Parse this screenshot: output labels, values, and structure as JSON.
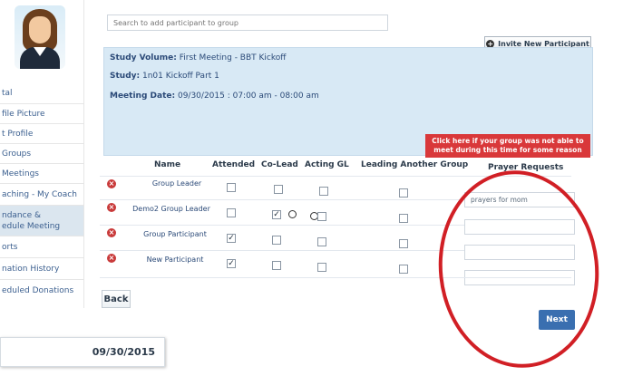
{
  "sidebar": {
    "items": [
      {
        "label": "tal"
      },
      {
        "label": "file Picture"
      },
      {
        "label": "t Profile"
      },
      {
        "label": "Groups"
      },
      {
        "label": "Meetings"
      },
      {
        "label": "aching - My Coach"
      },
      {
        "label": "ndance &\nedule Meeting"
      },
      {
        "label": "orts"
      },
      {
        "label": "nation History"
      },
      {
        "label": "eduled Donations"
      }
    ]
  },
  "search": {
    "placeholder": "Search to add participant to group"
  },
  "invite_label": "Invite New Participant",
  "study_volume": {
    "label": "Study Volume:",
    "value": "First Meeting - BBT Kickoff"
  },
  "study": {
    "label": "Study:",
    "value": "1n01 Kickoff Part 1"
  },
  "meeting_date": {
    "label": "Meeting Date:",
    "value": "09/30/2015 : 07:00 am - 08:00 am"
  },
  "unable_button": "Click here if your group was not able to meet during this time for some reason",
  "columns": [
    "Name",
    "Attended",
    "Co-Lead",
    "Acting GL",
    "Leading Another Group",
    "Prayer Requests"
  ],
  "rows": [
    {
      "name": "Group Leader",
      "attended": false,
      "colead": false,
      "acting": false,
      "leading": false,
      "prayer": ""
    },
    {
      "name": "Demo2 Group Leader",
      "attended": false,
      "colead": true,
      "acting": false,
      "leading": false,
      "prayer": "prayers for mom"
    },
    {
      "name": "Group Participant",
      "attended": true,
      "colead": false,
      "acting": false,
      "leading": false,
      "prayer": ""
    },
    {
      "name": "New Participant",
      "attended": true,
      "colead": false,
      "acting": false,
      "leading": false,
      "prayer": ""
    }
  ],
  "back_label": "Back",
  "next_label": "Next",
  "date_popup": "09/30/2015",
  "colors": {
    "accent": "#3a6fb0",
    "danger": "#d9383a",
    "info_bg": "#d8e9f5",
    "highlight": "#d11f25"
  }
}
